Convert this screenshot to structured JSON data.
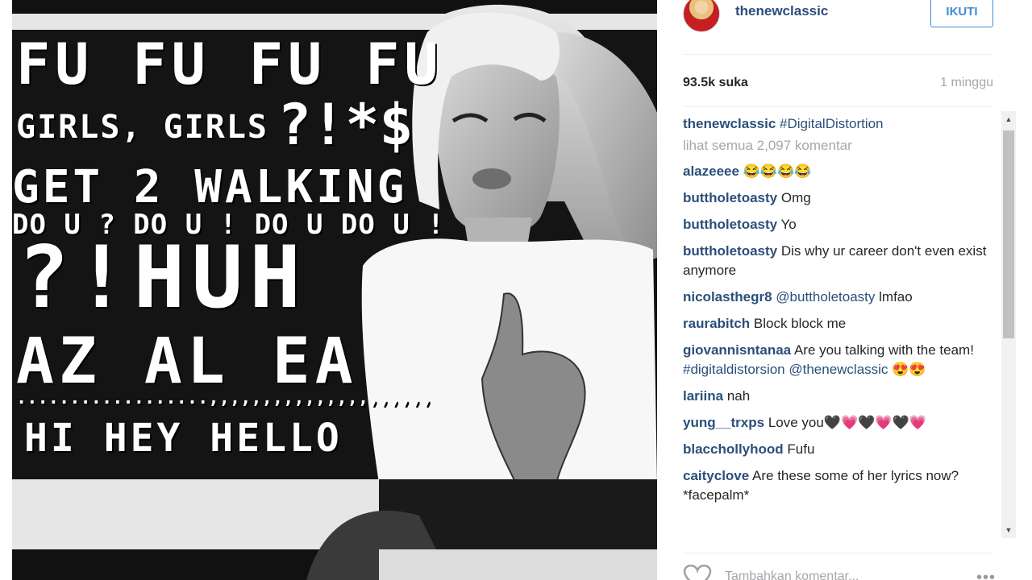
{
  "post": {
    "image_text": {
      "line1": "FU FU FU FU",
      "line2": "GIRLS, GIRLS",
      "line2_symbols": "?!*$",
      "line3": "GET 2 WALKING",
      "line4": "DO U ? DO U ! DO U DO U !",
      "line5": "?!HUH",
      "line6": "AZ AL EA",
      "line7": "..................,,,,,,,,,,,,,,,,,,,,,",
      "line8": "HI HEY HELLO"
    }
  },
  "header": {
    "username": "thenewclassic",
    "follow_label": "IKUTI"
  },
  "stats": {
    "likes": "93.5k suka",
    "time_ago": "1 minggu"
  },
  "caption": {
    "user": "thenewclassic",
    "text": "#DigitalDistortion"
  },
  "view_all_comments": "lihat semua 2,097 komentar",
  "comments": [
    {
      "user": "alazeeee",
      "text": "😂😂😂😂"
    },
    {
      "user": "buttholetoasty",
      "text": "Omg"
    },
    {
      "user": "buttholetoasty",
      "text": "Yo"
    },
    {
      "user": "buttholetoasty",
      "text": "Dis why ur career don't even exist anymore"
    },
    {
      "user": "nicolasthegr8",
      "mention": "@buttholetoasty",
      "text": "lmfao"
    },
    {
      "user": "raurabitch",
      "text": "Block block me"
    },
    {
      "user": "giovannisntanaa",
      "text": "Are you talking with the team!",
      "mention": "#digitaldistorsion @thenewclassic",
      "tail": "😍😍"
    },
    {
      "user": "lariina",
      "text": "nah"
    },
    {
      "user": "yung__trxps",
      "text": "Love you🖤💗🖤💗🖤💗"
    },
    {
      "user": "blacchollyhood",
      "text": "Fufu"
    },
    {
      "user": "caityclove",
      "text": "Are these some of her lyrics now? *facepalm*"
    }
  ],
  "add_comment": {
    "placeholder": "Tambahkan komentar..."
  },
  "icons": {
    "like": "heart-outline-icon",
    "more": "more-options-icon",
    "scroll_up": "scroll-up-arrow-icon",
    "scroll_down": "scroll-down-arrow-icon"
  },
  "colors": {
    "username_blue": "#2b4f7a",
    "follow_blue": "#3f8bd8",
    "muted_gray": "#a5a7aa"
  }
}
